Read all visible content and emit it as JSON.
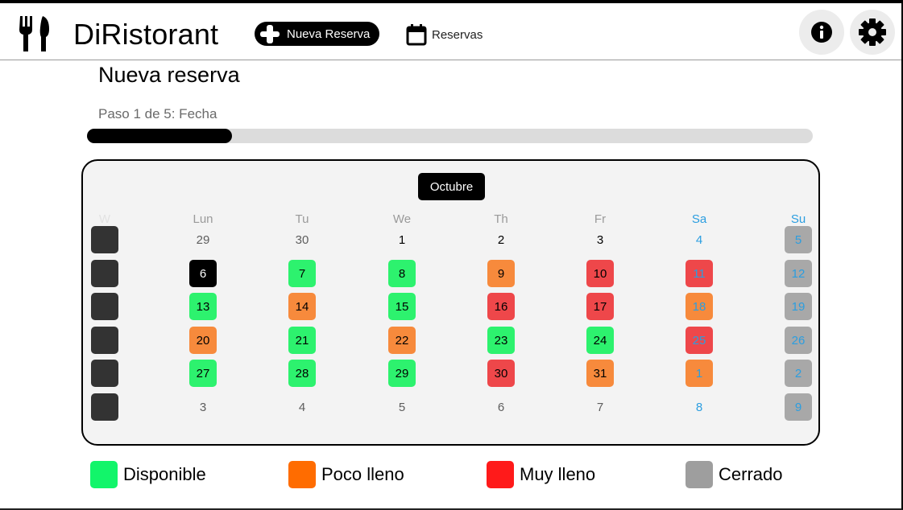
{
  "app": {
    "title": "DiRistorant"
  },
  "header": {
    "new_reservation_label": "Nueva Reserva",
    "reservations_label": "Reservas",
    "icons": [
      "utensils-icon",
      "plus-icon",
      "calendar-icon",
      "info-icon",
      "gear-icon"
    ]
  },
  "page": {
    "title": "Nueva reserva",
    "step_label": "Paso 1 de 5: Fecha",
    "progress": 0.2
  },
  "calendar": {
    "month": "Octubre",
    "weekdays": [
      "Lun",
      "Tu",
      "We",
      "Th",
      "Fr",
      "Sa",
      "Su"
    ],
    "week_column_header": "W",
    "weeks": [
      [
        {
          "day": "29",
          "other": true
        },
        {
          "day": "30",
          "other": true
        },
        {
          "day": "1",
          "status": "none"
        },
        {
          "day": "2",
          "status": "none"
        },
        {
          "day": "3",
          "status": "none"
        },
        {
          "day": "4",
          "weekend": true
        },
        {
          "day": "5",
          "status": "closed",
          "weekend": true
        }
      ],
      [
        {
          "day": "6",
          "status": "selected"
        },
        {
          "day": "7",
          "status": "available"
        },
        {
          "day": "8",
          "status": "available"
        },
        {
          "day": "9",
          "status": "busy"
        },
        {
          "day": "10",
          "status": "full"
        },
        {
          "day": "11",
          "status": "full",
          "weekend": true
        },
        {
          "day": "12",
          "status": "closed",
          "weekend": true
        }
      ],
      [
        {
          "day": "13",
          "status": "available"
        },
        {
          "day": "14",
          "status": "busy"
        },
        {
          "day": "15",
          "status": "available"
        },
        {
          "day": "16",
          "status": "full"
        },
        {
          "day": "17",
          "status": "full"
        },
        {
          "day": "18",
          "status": "busy",
          "weekend": true
        },
        {
          "day": "19",
          "status": "closed",
          "weekend": true
        }
      ],
      [
        {
          "day": "20",
          "status": "busy"
        },
        {
          "day": "21",
          "status": "available"
        },
        {
          "day": "22",
          "status": "busy"
        },
        {
          "day": "23",
          "status": "available"
        },
        {
          "day": "24",
          "status": "available"
        },
        {
          "day": "25",
          "status": "full",
          "weekend": true
        },
        {
          "day": "26",
          "status": "closed",
          "weekend": true
        }
      ],
      [
        {
          "day": "27",
          "status": "available"
        },
        {
          "day": "28",
          "status": "available"
        },
        {
          "day": "29",
          "status": "available"
        },
        {
          "day": "30",
          "status": "full"
        },
        {
          "day": "31",
          "status": "busy"
        },
        {
          "day": "1",
          "status": "busy",
          "weekend": true
        },
        {
          "day": "2",
          "status": "closed",
          "weekend": true
        }
      ],
      [
        {
          "day": "3",
          "other": true
        },
        {
          "day": "4",
          "other": true
        },
        {
          "day": "5",
          "other": true
        },
        {
          "day": "6",
          "other": true
        },
        {
          "day": "7",
          "other": true
        },
        {
          "day": "8",
          "weekend": true
        },
        {
          "day": "9",
          "status": "closed",
          "weekend": true
        }
      ]
    ]
  },
  "legend": [
    {
      "label": "Disponible",
      "color": "#12f56a"
    },
    {
      "label": "Poco lleno",
      "color": "#ff6c00"
    },
    {
      "label": "Muy lleno",
      "color": "#ff1a1a"
    },
    {
      "label": "Cerrado",
      "color": "#9e9e9e"
    }
  ],
  "colors": {
    "available": "#2df26e",
    "busy": "#f78a3c",
    "full": "#ee474a",
    "closed": "#a8a8a8",
    "weekend_text": "#2b9ee0"
  }
}
